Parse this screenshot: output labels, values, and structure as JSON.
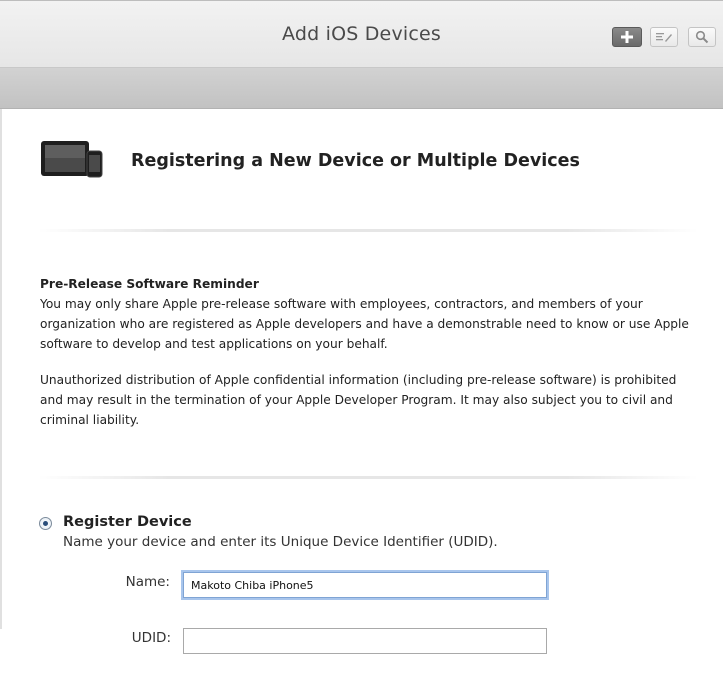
{
  "header": {
    "title": "Add iOS Devices",
    "add_icon": "plus-icon",
    "edit_icon": "edit-icon",
    "search_icon": "search-icon"
  },
  "section": {
    "icon": "ios-devices-icon",
    "title": "Registering a New Device or Multiple Devices"
  },
  "notice": {
    "heading": "Pre-Release Software Reminder",
    "paragraph1": "You may only share Apple pre-release software with employees, contractors, and members of your organization who are registered as Apple developers and have a demonstrable need to know or use Apple software to develop and test applications on your behalf.",
    "paragraph2": "Unauthorized distribution of Apple confidential information (including pre-release software) is prohibited and may result in the termination of your Apple Developer Program. It may also subject you to civil and criminal liability."
  },
  "register": {
    "selected": true,
    "title": "Register Device",
    "description": "Name your device and enter its Unique Device Identifier (UDID).",
    "name_label": "Name:",
    "name_value": "Makoto Chiba iPhone5",
    "udid_label": "UDID:",
    "udid_value": ""
  }
}
